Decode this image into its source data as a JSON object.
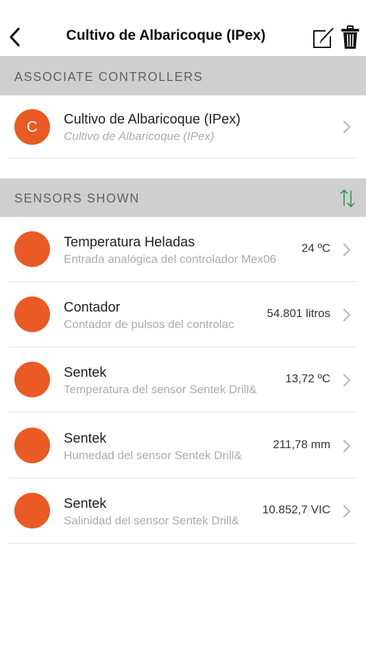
{
  "navbar": {
    "title": "Cultivo de Albaricoque (IPex)"
  },
  "icons": {
    "back": "chevron-left-icon",
    "edit": "edit-icon",
    "delete": "trash-icon",
    "sort": "sort-arrows-icon",
    "disclosure": "chevron-right-icon"
  },
  "colors": {
    "accent": "#ea5a24",
    "section_header_bg": "#cfcfcf",
    "sort_icon": "#2e8b57"
  },
  "controllers_section": {
    "header": "ASSOCIATE CONTROLLERS",
    "items": [
      {
        "initial": "C",
        "title": "Cultivo de Albaricoque (IPex)",
        "subtitle": "Cultivo de Albaricoque (IPex)"
      }
    ]
  },
  "sensors_section": {
    "header": "SENSORS SHOWN",
    "items": [
      {
        "title": "Temperatura Heladas",
        "subtitle": "Entrada analógica del controlador Mex06",
        "value": "24 ºC"
      },
      {
        "title": "Contador",
        "subtitle": "Contador de pulsos del controlac",
        "value": "54.801 litros"
      },
      {
        "title": "Sentek",
        "subtitle": "Temperatura del sensor Sentek Drill&",
        "value": "13,72 ºC"
      },
      {
        "title": "Sentek",
        "subtitle": "Humedad del sensor Sentek Drill&",
        "value": "211,78 mm"
      },
      {
        "title": "Sentek",
        "subtitle": "Salinidad del sensor Sentek Drill&",
        "value": "10.852,7 VIC"
      }
    ]
  }
}
